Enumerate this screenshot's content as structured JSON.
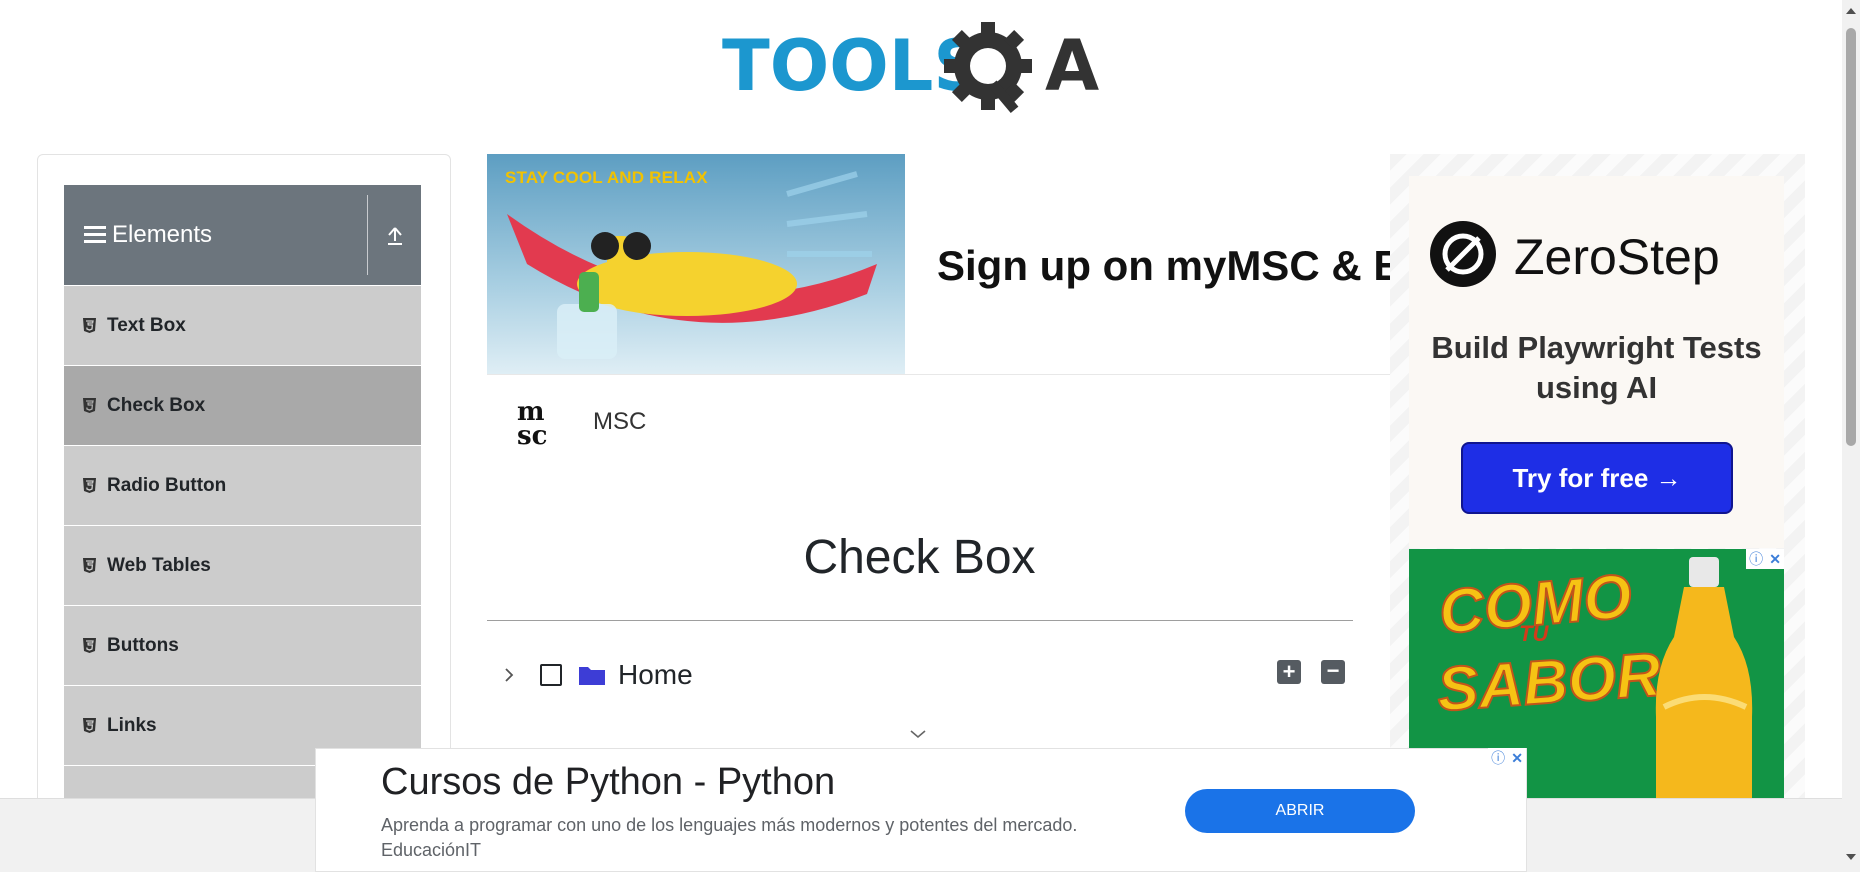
{
  "header": {
    "logo_text_left": "TOOLS",
    "logo_text_right": "A"
  },
  "sidebar": {
    "group_title": "Elements",
    "items": [
      {
        "label": "Text Box",
        "active": false
      },
      {
        "label": "Check Box",
        "active": true
      },
      {
        "label": "Radio Button",
        "active": false
      },
      {
        "label": "Web Tables",
        "active": false
      },
      {
        "label": "Buttons",
        "active": false
      },
      {
        "label": "Links",
        "active": false
      }
    ]
  },
  "ad_top": {
    "photo_text": "STAY COOL AND RELAX",
    "headline": "Sign up on myMSC & B",
    "brand_name": "MSC"
  },
  "main": {
    "title": "Check Box",
    "tree": {
      "root_label": "Home",
      "expand_all_symbol": "+",
      "collapse_all_symbol": "−"
    }
  },
  "ad_right": {
    "brand": "ZeroStep",
    "tagline": "Build Playwright Tests using AI",
    "cta": "Try for free →",
    "soda_line1": "COMO",
    "soda_line2": "TU",
    "soda_line3": "SABOR"
  },
  "ad_bottom": {
    "title": "Cursos de Python - Python",
    "description": "Aprenda a programar con uno de los lenguajes más modernos y potentes del mercado. EducaciónIT",
    "cta": "ABRIR"
  },
  "colors": {
    "logo_blue": "#1c97cf",
    "logo_dark": "#333333",
    "sidebar_header": "#6c757d",
    "menu_item": "#cccccc",
    "menu_item_active": "#a9a9a9",
    "zerostep_cta": "#1e2ee6",
    "bottom_cta": "#1a73e8"
  }
}
